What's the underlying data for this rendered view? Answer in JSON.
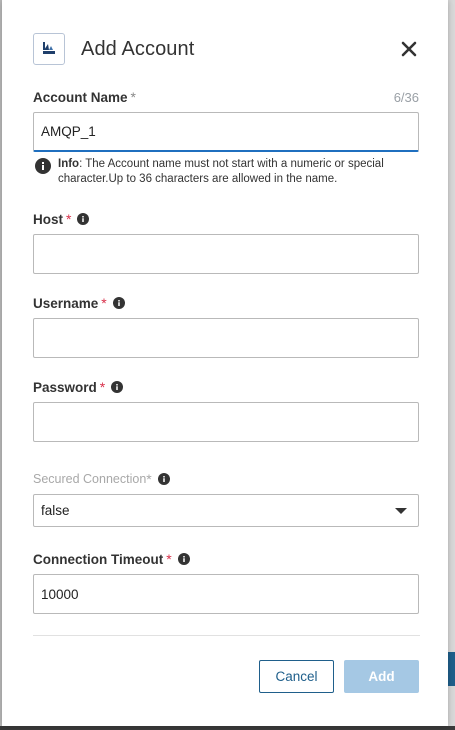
{
  "dialog": {
    "title": "Add Account",
    "close_icon": "close-icon",
    "logo_icon": "account-logo-icon"
  },
  "fields": {
    "account_name": {
      "label": "Account Name",
      "required_mark": "*",
      "value": "AMQP_1",
      "counter": "6/36"
    },
    "info": {
      "prefix": "Info",
      "text": ": The Account name must not start with a numeric or special character.Up to 36 characters are allowed in the name."
    },
    "host": {
      "label": "Host",
      "required_mark": "*",
      "value": ""
    },
    "username": {
      "label": "Username",
      "required_mark": "*",
      "value": ""
    },
    "password": {
      "label": "Password",
      "required_mark": "*",
      "value": ""
    },
    "secured_connection": {
      "label": "Secured Connection",
      "required_mark": "*",
      "selected": "false"
    },
    "connection_timeout": {
      "label": "Connection Timeout",
      "required_mark": "*",
      "value": "10000"
    }
  },
  "buttons": {
    "cancel_label": "Cancel",
    "add_label": "Add"
  },
  "colors": {
    "primary": "#1f5f8b",
    "focus": "#1f6fbf",
    "required": "#d9304a",
    "add_disabled": "#a5c8e4"
  }
}
